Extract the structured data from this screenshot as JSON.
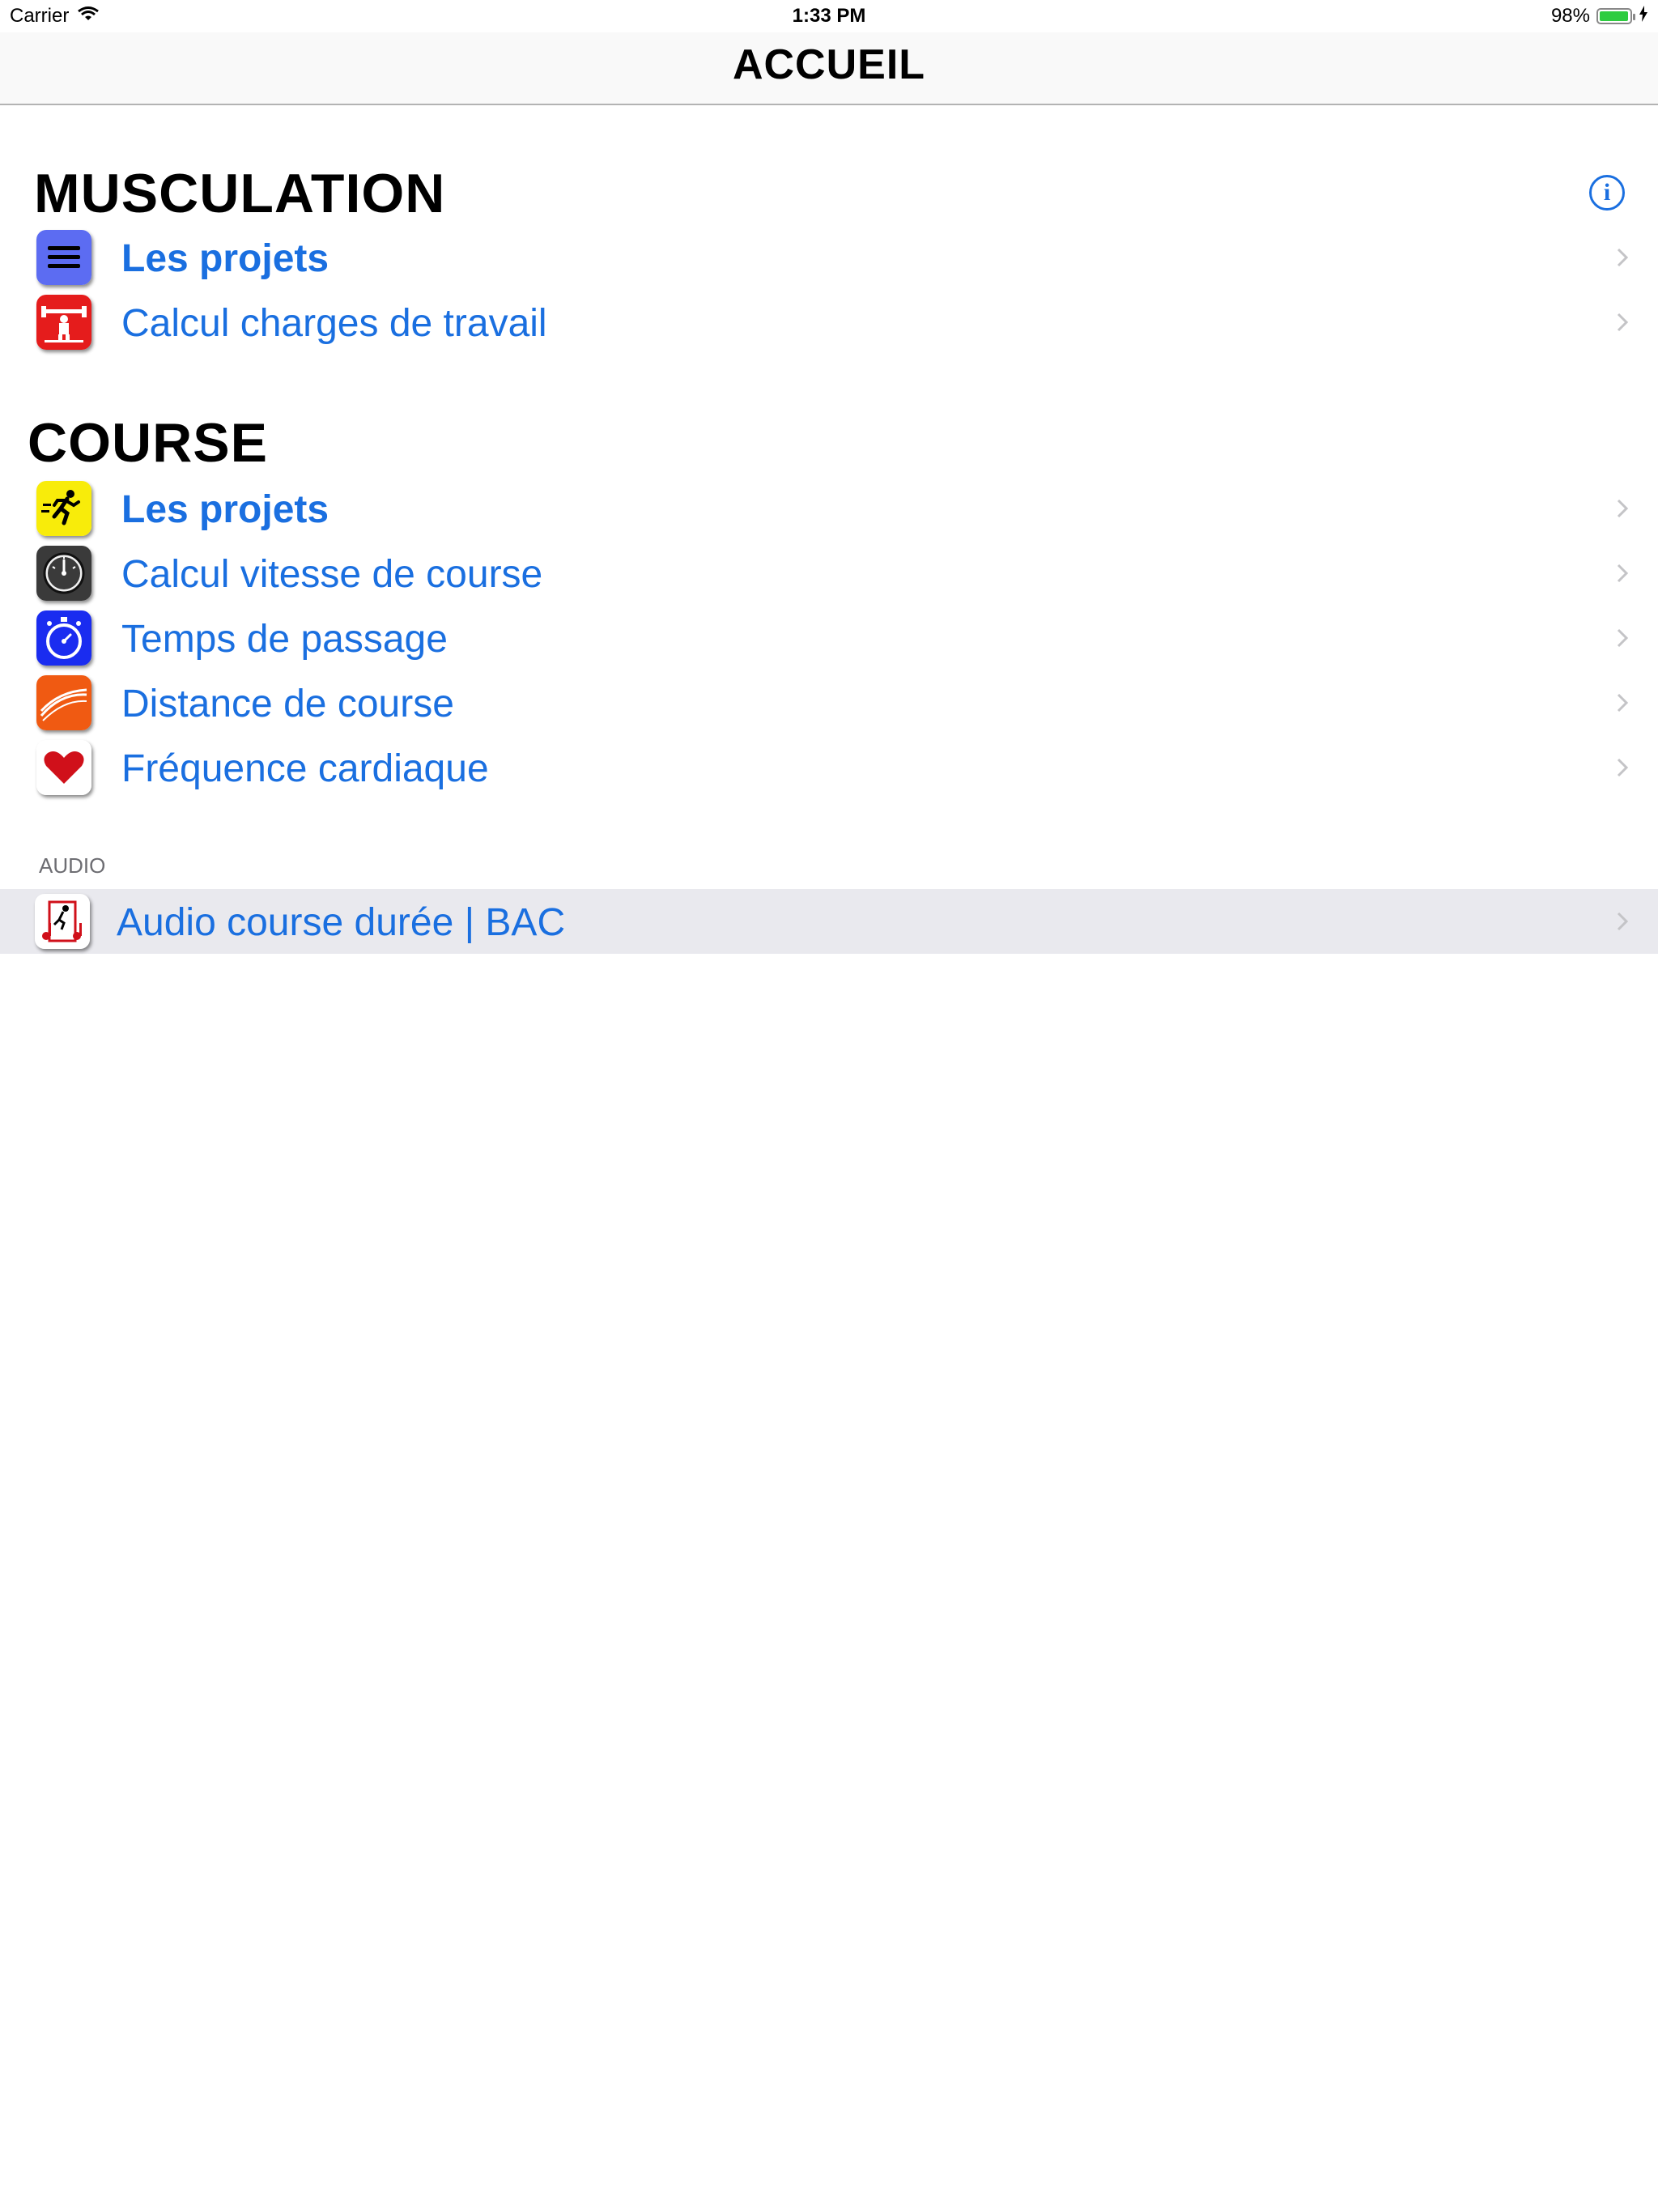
{
  "status_bar": {
    "carrier": "Carrier",
    "time": "1:33 PM",
    "battery": "98%",
    "battery_level": 0.98
  },
  "nav": {
    "title": "ACCUEIL"
  },
  "sections": {
    "musculation": {
      "title": "MUSCULATION",
      "items": [
        {
          "label": "Les projets",
          "icon": "list-icon"
        },
        {
          "label": "Calcul charges de travail",
          "icon": "weightlifter-icon"
        }
      ]
    },
    "course": {
      "title": "COURSE",
      "items": [
        {
          "label": "Les projets",
          "icon": "runner-icon"
        },
        {
          "label": "Calcul vitesse de course",
          "icon": "speedometer-icon"
        },
        {
          "label": "Temps de passage",
          "icon": "stopwatch-icon"
        },
        {
          "label": "Distance de course",
          "icon": "track-icon"
        },
        {
          "label": "Fréquence cardiaque",
          "icon": "heart-icon"
        }
      ]
    },
    "audio": {
      "title": "AUDIO",
      "items": [
        {
          "label": "Audio course durée | BAC",
          "icon": "music-runner-icon"
        }
      ]
    }
  },
  "colors": {
    "accent": "#1a6fe0",
    "highlight_row": "#e9e9ee",
    "section_caption": "#6d6d72"
  }
}
